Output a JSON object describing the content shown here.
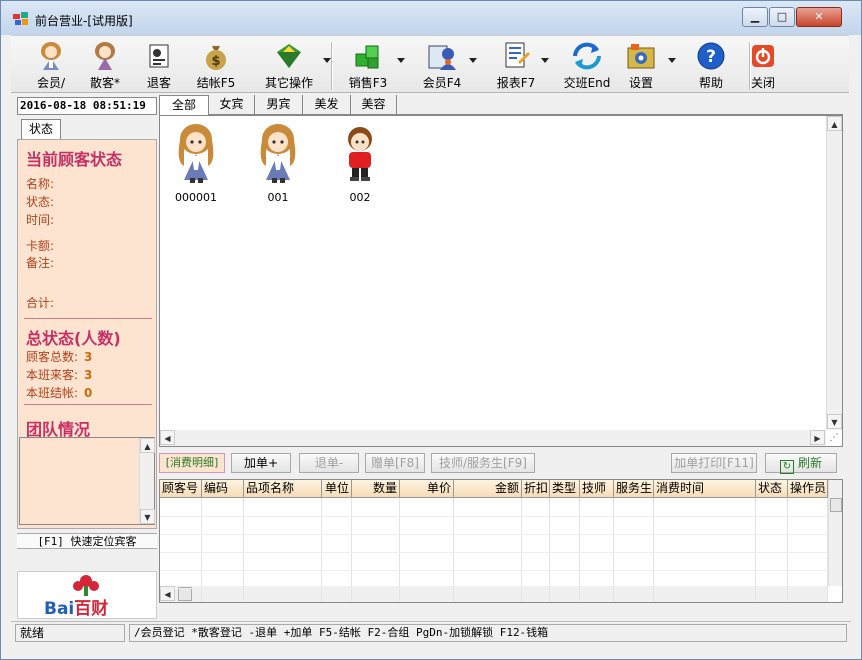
{
  "window": {
    "title": "前台营业-[试用版]",
    "minimize": "▁",
    "maximize": "□",
    "close": "✕"
  },
  "toolbar": [
    {
      "label": "会员/",
      "icon": "girl-member-icon",
      "dropdown": false
    },
    {
      "label": "散客*",
      "icon": "girl-walkin-icon",
      "dropdown": false
    },
    {
      "label": "退客",
      "icon": "checkout-guest-icon",
      "dropdown": false
    },
    {
      "label": "结帐F5",
      "icon": "money-bag-icon",
      "dropdown": false
    },
    {
      "label": "其它操作",
      "icon": "diamond-icon",
      "dropdown": true
    },
    {
      "label": "销售F3",
      "icon": "green-cubes-icon",
      "dropdown": true
    },
    {
      "label": "会员F4",
      "icon": "member-card-icon",
      "dropdown": true
    },
    {
      "label": "报表F7",
      "icon": "report-icon",
      "dropdown": true
    },
    {
      "label": "交班End",
      "icon": "shift-handover-icon",
      "dropdown": false
    },
    {
      "label": "设置",
      "icon": "settings-icon",
      "dropdown": true
    },
    {
      "label": "帮助",
      "icon": "help-icon",
      "dropdown": false
    },
    {
      "label": "关闭",
      "icon": "power-close-icon",
      "dropdown": false
    }
  ],
  "left": {
    "datetime": "2016-08-18 08:51:19",
    "tab": "状态",
    "current_heading": "当前顾客状态",
    "name_label": "名称:",
    "status_label": "状态:",
    "time_label": "时间:",
    "card_label": "卡额:",
    "remark_label": "备注:",
    "total_label": "合计:",
    "summary_heading": "总状态(人数)",
    "total_guests_label": "顾客总数:",
    "total_guests": "3",
    "shift_guests_label": "本班来客:",
    "shift_guests": "3",
    "shift_checkout_label": "本班结帐:",
    "shift_checkout": "0",
    "team_heading": "团队情况",
    "quick_locate": "[F1] 快速定位宾客",
    "logo_text_a": "Bai",
    "logo_text_b": "百财"
  },
  "tabs": [
    "全部",
    "女宾",
    "男宾",
    "美发",
    "美容"
  ],
  "guests": [
    {
      "id": "000001",
      "icon": "female-guest-icon"
    },
    {
      "id": "001",
      "icon": "female-guest-icon"
    },
    {
      "id": "002",
      "icon": "male-guest-icon"
    }
  ],
  "buttons": {
    "detail_label": "[消费明细]",
    "add": "加单+",
    "cancel": "退单-",
    "gift": "赠单[F8]",
    "staff": "技师/服务生[F9]",
    "print": "加单打印[F11]",
    "refresh": "刷新"
  },
  "grid_columns": [
    "顾客号",
    "编码",
    "品项名称",
    "单位",
    "数量",
    "单价",
    "金额",
    "折扣",
    "类型",
    "技师",
    "服务生",
    "消费时间",
    "状态",
    "操作员"
  ],
  "statusbar": {
    "state": "就绪",
    "hints": "/会员登记 *散客登记 -退单 +加单 F5-结帐 F2-合组 PgDn-加锁解锁 F12-钱箱"
  },
  "colors": {
    "heading": "#c83064",
    "label": "#b0401c",
    "value": "#d06a0e",
    "panel_bg": "#fde4d0"
  }
}
